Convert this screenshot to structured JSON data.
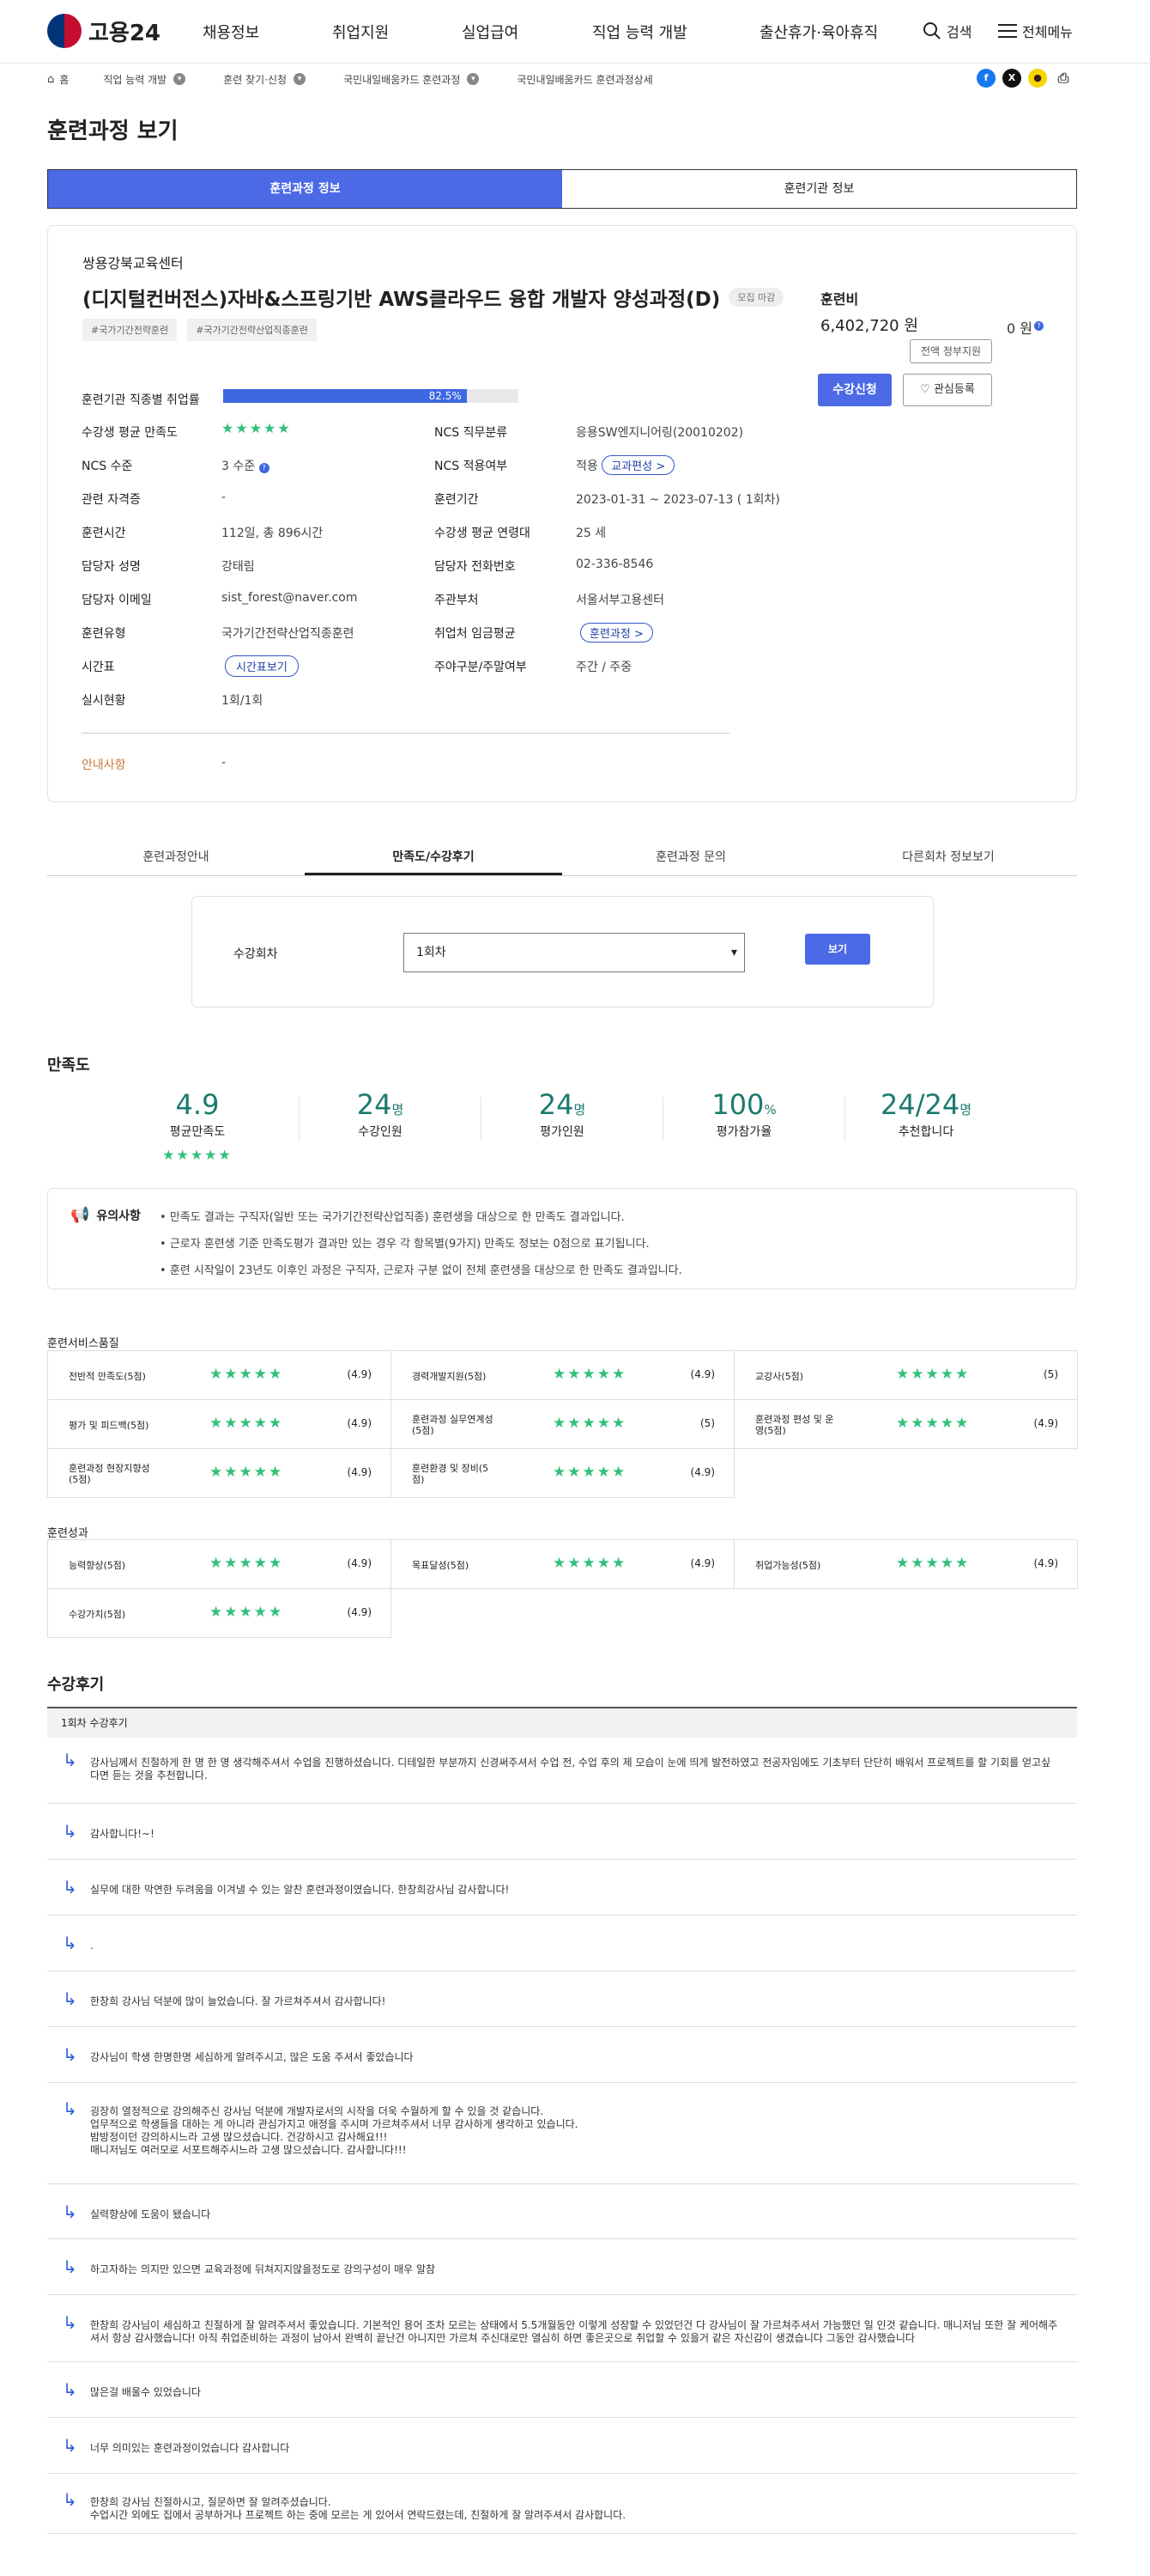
{
  "header": {
    "logo_text": "고용24",
    "nav": [
      "채용정보",
      "취업지원",
      "실업급여",
      "직업 능력 개발",
      "출산휴가·육아휴직"
    ],
    "search_label": "검색",
    "menu_label": "전체메뉴"
  },
  "breadcrumb": [
    "홈",
    "직업 능력 개발",
    "훈련 찾기·신청",
    "국민내일배움카드 훈련과정",
    "국민내일배움카드 훈련과정상세"
  ],
  "page_title": "훈련과정 보기",
  "top_tabs": [
    "훈련과정 정보",
    "훈련기관 정보"
  ],
  "course": {
    "institution": "쌍용강북교육센터",
    "title": "(디지털컨버전스)자바&스프링기반 AWS클라우드 융합 개발자 양성과정(D)",
    "status_badge": "모집 마감",
    "tags": [
      "#국가기간전략훈련",
      "#국가기간전략산업직종훈련"
    ],
    "fee_label": "훈련비",
    "fee_amount": "6,402,720 원",
    "self_pay": "0 원",
    "support_button": "전액 정부지원",
    "apply_button": "수강신청",
    "wish_button": "관심등록"
  },
  "details": {
    "employment_rate_label": "훈련기관 직종별 취업률",
    "employment_rate": "82.5%",
    "employment_rate_value": 0.825,
    "satisfaction_label": "수강생 평균 만족도",
    "satisfaction_stars": "★★★★★",
    "ncs_level_label": "NCS 수준",
    "ncs_level": "3 수준",
    "ncs_duty_label": "NCS 직무분류",
    "ncs_duty": "응용SW엔지니어링(20010202)",
    "ncs_apply_label": "NCS 적용여부",
    "ncs_apply": "적용",
    "curriculum_btn": "교과편성 >",
    "cert_label": "관련 자격증",
    "cert": "-",
    "period_label": "훈련기간",
    "period": "2023-01-31 ~ 2023-07-13 ( 1회차)",
    "hours_label": "훈련시간",
    "hours": "112일, 총 896시간",
    "age_label": "수강생 평균 연령대",
    "age": "25 세",
    "manager_label": "담당자 성명",
    "manager": "강태림",
    "phone_label": "담당자 전화번호",
    "phone": "02-336-8546",
    "email_label": "담당자 이메일",
    "email": "sist_forest@naver.com",
    "office_label": "주관부처",
    "office": "서울서부고용센터",
    "type_label": "훈련유형",
    "type": "국가기간전략산업직종훈련",
    "wage_label": "취업처 임금평균",
    "wage_btn": "훈련과정 >",
    "schedule_label": "시간표",
    "schedule_btn": "시간표보기",
    "daynight_label": "주야구분/주말여부",
    "daynight": "주간 / 주중",
    "practice_label": "실시현황",
    "practice": "1회/1회",
    "notice_label": "안내사항",
    "notice": "-"
  },
  "sub_tabs": [
    "훈련과정안내",
    "만족도/수강후기",
    "훈련과정 문의",
    "다른회차 정보보기"
  ],
  "round_select": {
    "label": "수강회차",
    "value": "1회차",
    "button": "보기"
  },
  "satisfaction": {
    "heading": "만족도",
    "stats": [
      {
        "num": "4.9",
        "unit": "",
        "cap": "평균만족도"
      },
      {
        "num": "24",
        "unit": "명",
        "cap": "수강인원"
      },
      {
        "num": "24",
        "unit": "명",
        "cap": "평가인원"
      },
      {
        "num": "100",
        "unit": "%",
        "cap": "평가참가율"
      },
      {
        "num": "24/24",
        "unit": "명",
        "cap": "추천합니다"
      }
    ],
    "avg_stars": "★★★★★",
    "notice_title": "유의사항",
    "notices": [
      "만족도 결과는 구직자(일반 또는 국가기간전략산업직종) 훈련생을 대상으로 한 만족도 결과입니다.",
      "근로자 훈련생 기준 만족도평가 결과만 있는 경우 각 항목별(9가지) 만족도 정보는 0점으로 표기됩니다.",
      "훈련 시작일이 23년도 이후인 과정은 구직자, 근로자 구분 없이 전체 훈련생을 대상으로 한 만족도 결과입니다."
    ]
  },
  "service_quality": {
    "heading": "훈련서비스품질",
    "items": [
      {
        "name": "전반적 만족도(5점)",
        "stars": "★★★★★",
        "value": "(4.9)"
      },
      {
        "name": "경력개발지원(5점)",
        "stars": "★★★★★",
        "value": "(4.9)"
      },
      {
        "name": "교강사(5점)",
        "stars": "★★★★★",
        "value": "(5)"
      },
      {
        "name": "평가 및 피드백(5점)",
        "stars": "★★★★★",
        "value": "(4.9)"
      },
      {
        "name": "훈련과정 실무연계성(5점)",
        "stars": "★★★★★",
        "value": "(5)"
      },
      {
        "name": "훈련과정 편성 및 운영(5점)",
        "stars": "★★★★★",
        "value": "(4.9)"
      },
      {
        "name": "훈련과정 현장지향성(5점)",
        "stars": "★★★★★",
        "value": "(4.9)"
      },
      {
        "name": "훈련환경 및 장비(5점)",
        "stars": "★★★★★",
        "value": "(4.9)"
      }
    ]
  },
  "outcome": {
    "heading": "훈련성과",
    "items": [
      {
        "name": "능력향상(5점)",
        "stars": "★★★★★",
        "value": "(4.9)"
      },
      {
        "name": "목표달성(5점)",
        "stars": "★★★★★",
        "value": "(4.9)"
      },
      {
        "name": "취업가능성(5점)",
        "stars": "★★★★★",
        "value": "(4.9)"
      },
      {
        "name": "수강가치(5점)",
        "stars": "★★★★★",
        "value": "(4.9)"
      }
    ]
  },
  "reviews": {
    "heading": "수강후기",
    "round_label": "1회차 수강후기",
    "items": [
      "강사님께서 친절하게 한 명 한 명 생각해주셔서 수업을 진행하셨습니다. 디테일한 부분까지 신경써주셔서 수업 전, 수업 후의 제 모습이 눈에 띄게 발전하였고 전공자임에도 기초부터 단단히 배워서 프로젝트를 할 기회를 얻고싶다면 듣는 것을 추천합니다.",
      "감사합니다!~!",
      "실무에 대한 막연한 두려움을 이겨낼 수 있는 알찬 훈련과정이였습니다. 한창희강사님 감사합니다!",
      ".",
      "한창희 강사님 덕분에 많이 늘었습니다. 잘 가르쳐주셔서 감사합니다!",
      "강사님이 학생 한명한명 세심하게 알려주시고, 많은 도움 주셔서 좋았습니다",
      "굉장히 열정적으로 강의해주신 강사님 덕분에 개발자로서의 시작을 더욱 수월하게 할 수 있을 것 같습니다.\n업무적으로 학생들을 대하는 게 아니라 관심가지고 애정을 주시며 가르쳐주셔서 너무 감사하게 생각하고 있습니다.\n밤방정이던 강의하시느라 고생 많으셨습니다. 건강하시고 감사해요!!!\n매니저님도 여러모로 서포트해주시느라 고생 많으셨습니다. 감사합니다!!!",
      "실력향상에 도움이 됐습니다",
      "하고자하는 의지만 있으면 교육과정에 뒤쳐지지않을정도로 강의구성이 매우 알참",
      "한창희 강사님이 세심하고 친절하게 잘 알려주셔서 좋았습니다. 기본적인 용어 조차 모르는 상태에서 5.5개월동안 이렇게 성장할 수 있었던건 다 강사님이 잘 가르쳐주셔서 가능했던 일 인것 같습니다. 매니저님 또한 잘 케어해주셔서 항상 감사했습니다! 아직 취업준비하는 과정이 남아서 완벽히 끝난건 아니지만 가르쳐 주신대로만 열심히 하면 좋은곳으로 취업할 수 있을거 같은 자신감이 생겼습니다 그동안 감사했습니다",
      "많은걸 배울수 있었습니다",
      "너무 의미있는 훈련과정이었습니다 감사합니다",
      "한창희 강사님 친절하시고, 질문하면 잘 알려주셨습니다.\n수업시간 외에도 집에서 공부하거나 프로젝트 하는 중에 모르는 게 있어서 연락드렸는데, 친절하게 잘 알려주셔서 감사합니다."
    ]
  },
  "colors": {
    "primary": "#4c6ae6",
    "star": "#33c07a",
    "stat": "#1d7a6e",
    "notice_label": "#c87a3a"
  }
}
